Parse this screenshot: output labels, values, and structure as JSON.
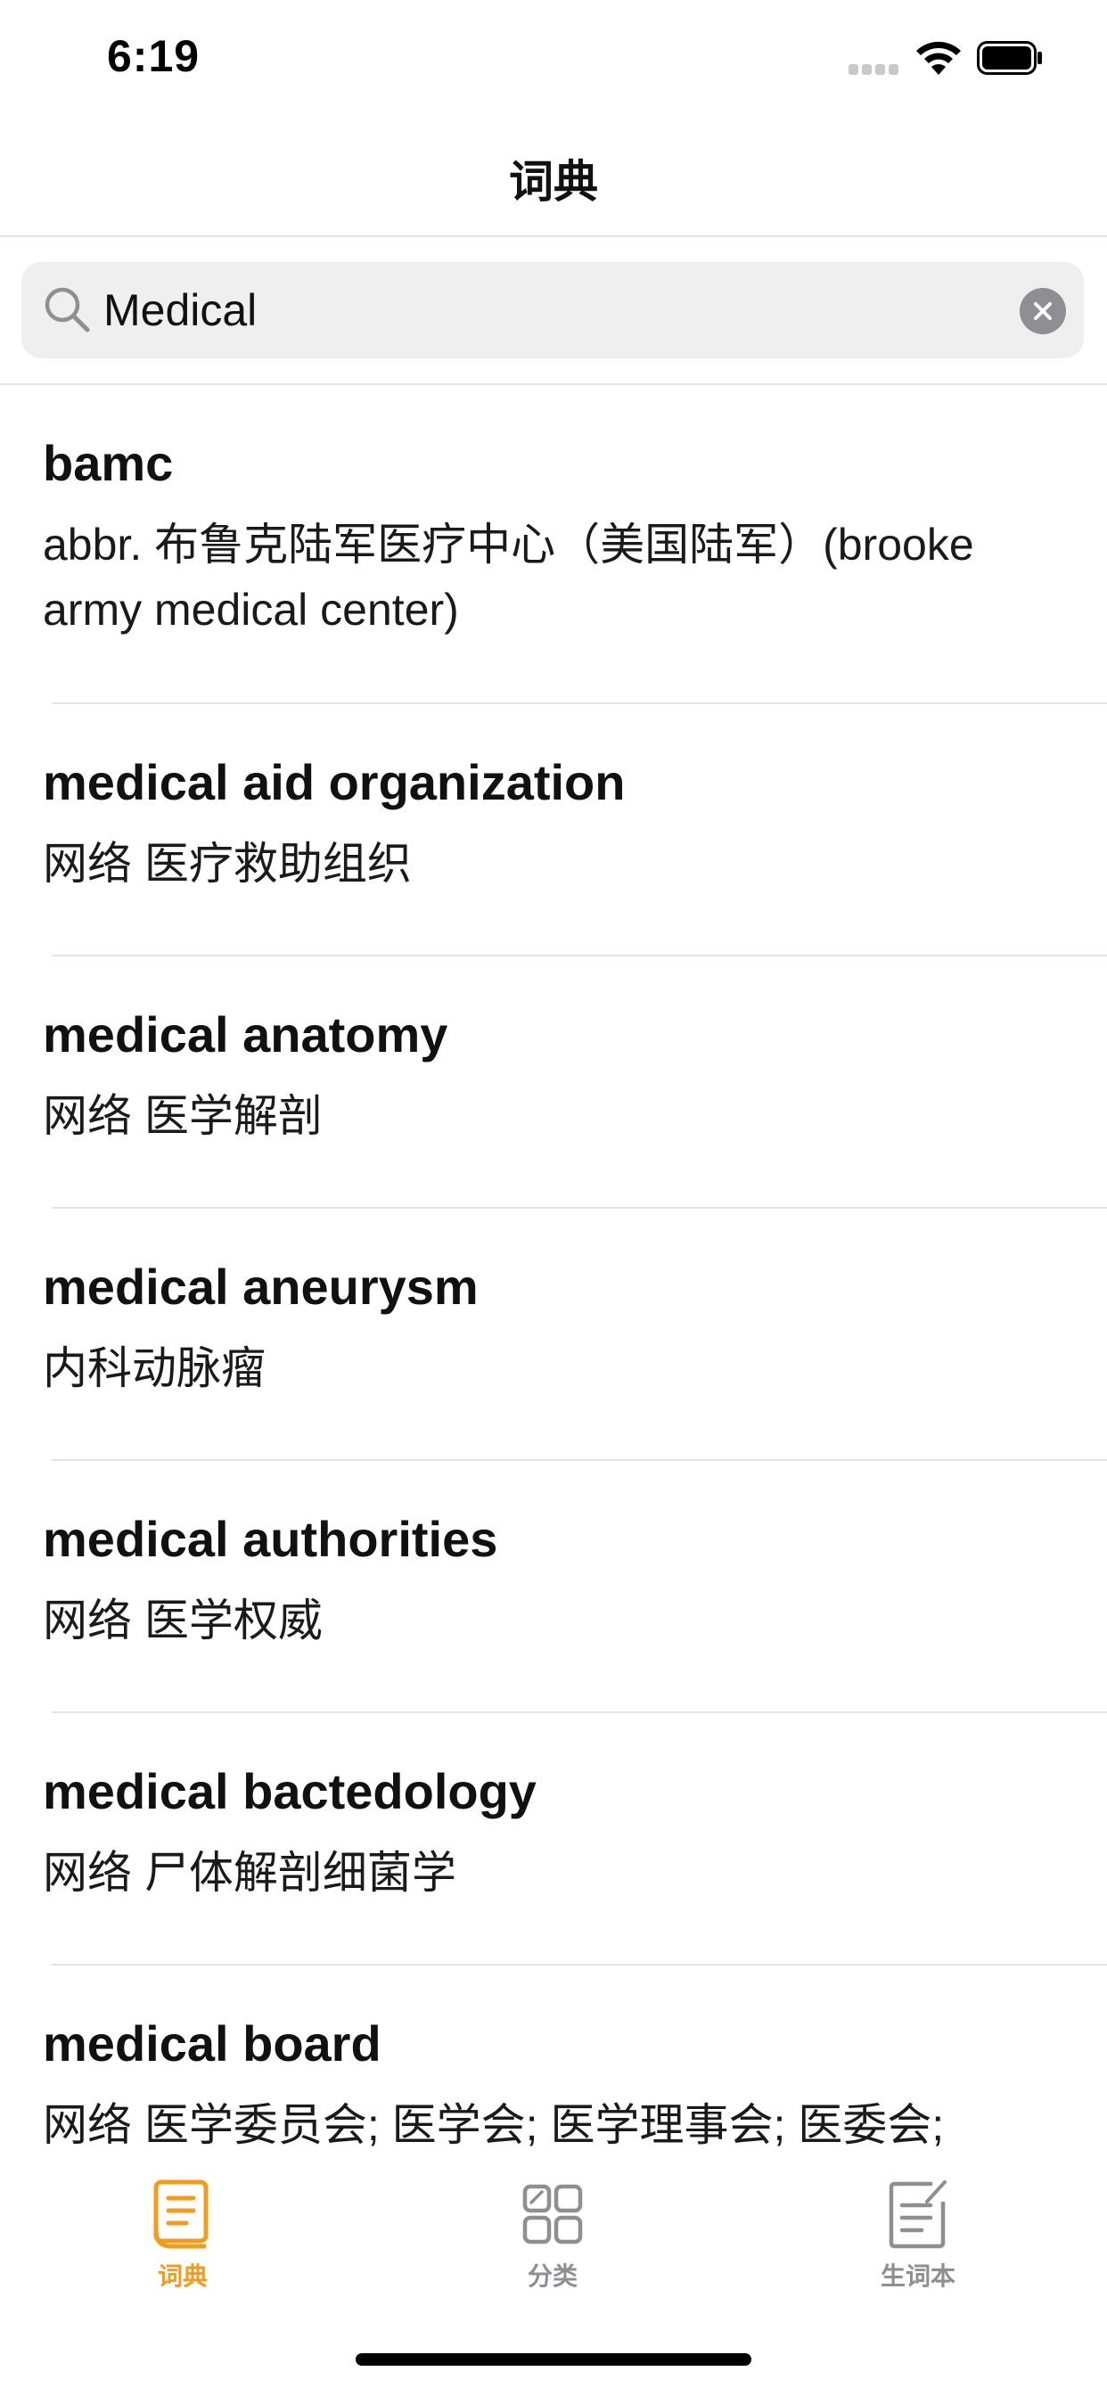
{
  "status_bar": {
    "time": "6:19"
  },
  "nav": {
    "title": "词典"
  },
  "search": {
    "value": "Medical",
    "placeholder": ""
  },
  "results": [
    {
      "word": "bamc",
      "definition": "abbr.  布鲁克陆军医疗中心（美国陆军）(brooke army medical center)"
    },
    {
      "word": "medical aid organization",
      "definition": "网络  医疗救助组织"
    },
    {
      "word": "medical anatomy",
      "definition": "网络  医学解剖"
    },
    {
      "word": "medical aneurysm",
      "definition": "内科动脉瘤"
    },
    {
      "word": "medical authorities",
      "definition": "网络  医学权威"
    },
    {
      "word": "medical bactedology",
      "definition": "网络  尸体解剖细菌学"
    },
    {
      "word": "medical board",
      "definition": "网络  医学委员会; 医学会; 医学理事会; 医委会;"
    }
  ],
  "tabs": [
    {
      "label": "词典",
      "icon": "dictionary-book-icon",
      "active": true
    },
    {
      "label": "分类",
      "icon": "category-grid-icon",
      "active": false
    },
    {
      "label": "生词本",
      "icon": "vocabulary-notebook-icon",
      "active": false
    }
  ],
  "colors": {
    "accent": "#F29B1D",
    "inactive": "#8E8E93",
    "separator": "#E4E4E4",
    "search_bg": "#EFEFEF"
  }
}
